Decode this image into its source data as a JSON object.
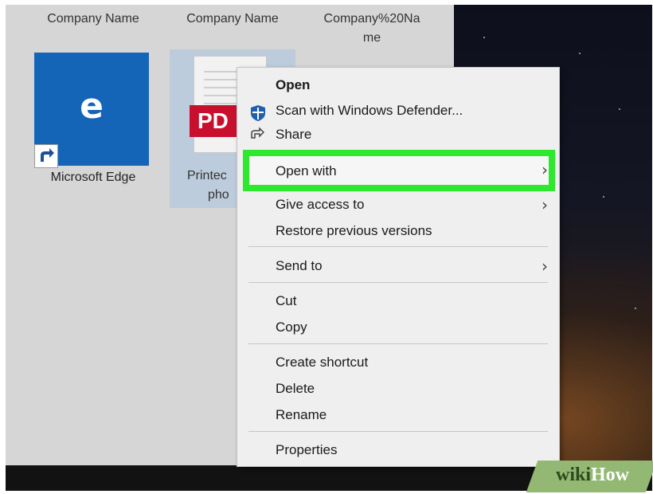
{
  "explorer": {
    "columns": [
      "Company Name",
      "Company Name",
      "Company%20Na me"
    ],
    "column_1": "Company Name",
    "column_2": "Company Name",
    "column_3_line1": "Company%20Na",
    "column_3_line2": "me",
    "edge_label": "Microsoft Edge",
    "pdf_label_line1": "Printec",
    "pdf_label_line2": "pho",
    "pdf_badge": "PD"
  },
  "context_menu": {
    "open": "Open",
    "scan": "Scan with Windows Defender...",
    "share": "Share",
    "open_with": "Open with",
    "give_access": "Give access to",
    "restore": "Restore previous versions",
    "send_to": "Send to",
    "cut": "Cut",
    "copy": "Copy",
    "create_shortcut": "Create shortcut",
    "delete": "Delete",
    "rename": "Rename",
    "properties": "Properties",
    "submenu_chevron": "›"
  },
  "watermark": {
    "wiki": "wiki",
    "how": "How"
  },
  "colors": {
    "highlight": "#2de82d",
    "edge_tile": "#1464b8",
    "pdf_badge": "#c8102e",
    "explorer_bg": "#d6d6d6",
    "menu_bg": "#efefef"
  },
  "icons": {
    "edge": "microsoft-edge-icon",
    "shortcut": "shortcut-arrow-icon",
    "pdf": "pdf-file-icon",
    "shield": "windows-defender-shield-icon",
    "share": "share-icon",
    "chevron": "chevron-right-icon"
  }
}
